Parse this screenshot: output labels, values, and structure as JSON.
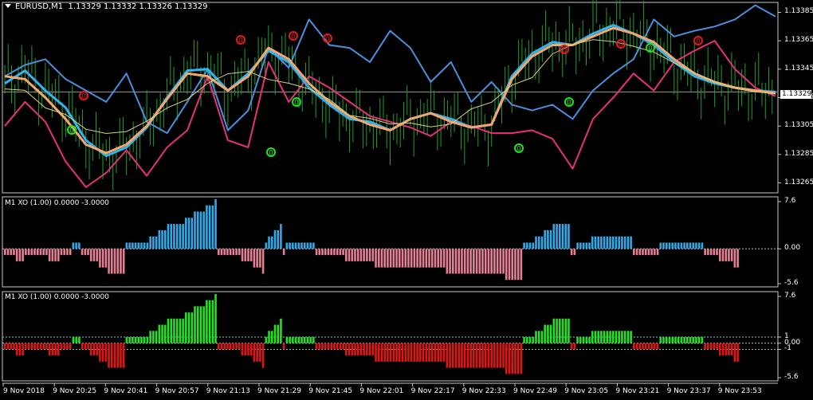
{
  "window": {
    "symbol_header": "EURUSD,M1  1.13329 1.13332 1.13326 1.13329",
    "current_price": "1.13329"
  },
  "price_axis": {
    "labels": [
      "1.13385",
      "1.13365",
      "1.13345",
      "1.13325",
      "1.13305",
      "1.13285",
      "1.13265"
    ],
    "ylim": [
      1.13258,
      1.13392
    ]
  },
  "indicator1": {
    "label": "M1 XO (1.00) 0.0000 -3.0000",
    "scale_labels": [
      "7.6",
      "0.00",
      "-5.6"
    ],
    "ylim": [
      -5.6,
      7.6
    ],
    "colors": {
      "up": "#30a9e8",
      "down": "#e57f94"
    }
  },
  "indicator2": {
    "label": "M1 XO (1.00) 0.0000 -3.0000",
    "scale_labels": [
      "7.6",
      "1",
      "0.00",
      "-1",
      "-5.6"
    ],
    "ylim": [
      -5.6,
      7.6
    ],
    "colors": {
      "up": "#22e11f",
      "down": "#e01512"
    }
  },
  "time_axis": {
    "labels": [
      "9 Nov 2018",
      "9 Nov 20:25",
      "9 Nov 20:41",
      "9 Nov 20:57",
      "9 Nov 21:13",
      "9 Nov 21:29",
      "9 Nov 21:45",
      "9 Nov 22:01",
      "9 Nov 22:17",
      "9 Nov 22:33",
      "9 Nov 22:49",
      "9 Nov 23:05",
      "9 Nov 23:21",
      "9 Nov 23:37",
      "9 Nov 23:53"
    ]
  },
  "markers": {
    "sell_glyph": "0",
    "buy_glyph": "0",
    "sell_color": "#e01b1b",
    "buy_color": "#22e11f"
  },
  "chart_data": [
    {
      "type": "line",
      "title": "EURUSD,M1",
      "series": [
        {
          "name": "",
          "color": "#4b8fdc",
          "x": [
            0,
            6,
            12,
            18,
            24,
            30,
            36,
            42,
            48,
            54,
            60,
            66,
            72,
            78,
            84,
            90,
            96,
            102,
            108,
            114,
            120,
            126,
            132,
            138,
            144,
            150,
            156,
            162,
            168,
            174,
            180,
            186,
            192,
            198,
            204,
            210,
            216,
            222,
            228
          ],
          "values": [
            1.1334,
            1.13348,
            1.13352,
            1.13338,
            1.1333,
            1.13322,
            1.13342,
            1.13308,
            1.133,
            1.13322,
            1.13345,
            1.13302,
            1.13316,
            1.1336,
            1.13346,
            1.1338,
            1.13362,
            1.1336,
            1.1335,
            1.13372,
            1.1336,
            1.13336,
            1.1335,
            1.13322,
            1.13336,
            1.1332,
            1.13316,
            1.1332,
            1.1331,
            1.1333,
            1.13342,
            1.13352,
            1.1338,
            1.13368,
            1.13372,
            1.13375,
            1.1338,
            1.1339,
            1.13382
          ]
        },
        {
          "name": "",
          "color": "#e8307a",
          "x": [
            0,
            6,
            12,
            18,
            24,
            30,
            36,
            42,
            48,
            54,
            60,
            66,
            72,
            78,
            84,
            90,
            96,
            102,
            108,
            114,
            120,
            126,
            132,
            138,
            144,
            150,
            156,
            162,
            168,
            174,
            180,
            186,
            192,
            198,
            204,
            210,
            216,
            222,
            228
          ],
          "values": [
            1.13305,
            1.13322,
            1.13308,
            1.1328,
            1.13262,
            1.13272,
            1.13288,
            1.1327,
            1.1329,
            1.13302,
            1.1334,
            1.13295,
            1.1329,
            1.1335,
            1.13322,
            1.1334,
            1.13332,
            1.13322,
            1.13312,
            1.13308,
            1.13304,
            1.13298,
            1.13308,
            1.13305,
            1.133,
            1.133,
            1.13302,
            1.13296,
            1.13275,
            1.1331,
            1.13325,
            1.13342,
            1.1333,
            1.1335,
            1.13358,
            1.13365,
            1.13345,
            1.13332,
            1.13326
          ]
        },
        {
          "name": "",
          "color": "#31b4f2",
          "x": [
            0,
            6,
            12,
            18,
            24,
            30,
            36,
            42,
            48,
            54,
            60,
            66,
            72,
            78,
            84,
            90,
            96,
            102,
            108,
            114,
            120,
            126,
            132,
            138,
            144,
            150,
            156,
            162,
            168,
            174,
            180,
            186,
            192,
            198,
            204,
            210,
            216,
            222,
            228
          ],
          "values": [
            1.13335,
            1.13344,
            1.1333,
            1.13318,
            1.13295,
            1.13284,
            1.1329,
            1.13304,
            1.13325,
            1.13344,
            1.13345,
            1.1333,
            1.13342,
            1.13358,
            1.1335,
            1.13332,
            1.1332,
            1.1331,
            1.13308,
            1.13302,
            1.1331,
            1.13314,
            1.1331,
            1.13304,
            1.13306,
            1.1334,
            1.13356,
            1.13364,
            1.13362,
            1.1337,
            1.13376,
            1.1337,
            1.13362,
            1.1335,
            1.1334,
            1.13335,
            1.13332,
            1.1333,
            1.13329
          ]
        },
        {
          "name": "",
          "color": "#f5a66c",
          "x": [
            0,
            6,
            12,
            18,
            24,
            30,
            36,
            42,
            48,
            54,
            60,
            66,
            72,
            78,
            84,
            90,
            96,
            102,
            108,
            114,
            120,
            126,
            132,
            138,
            144,
            150,
            156,
            162,
            168,
            174,
            180,
            186,
            192,
            198,
            204,
            210,
            216,
            222,
            228
          ],
          "values": [
            1.1334,
            1.13338,
            1.13325,
            1.1331,
            1.13292,
            1.13286,
            1.13292,
            1.13305,
            1.13324,
            1.13342,
            1.1334,
            1.1333,
            1.1334,
            1.1336,
            1.13352,
            1.13335,
            1.13322,
            1.13312,
            1.13306,
            1.13302,
            1.1331,
            1.13314,
            1.13308,
            1.13304,
            1.13306,
            1.13338,
            1.13354,
            1.13362,
            1.13362,
            1.13368,
            1.13374,
            1.1337,
            1.13364,
            1.13352,
            1.13342,
            1.13336,
            1.13332,
            1.1333,
            1.13328
          ]
        }
      ]
    },
    {
      "type": "bar",
      "title": "M1 XO (1.00) 0.0000 -3.0000",
      "ylim": [
        -5.6,
        7.6
      ],
      "values": [
        -1,
        -1,
        -1,
        -1,
        -2,
        -2,
        -2,
        -1,
        -1,
        -1,
        -1,
        -1,
        -1,
        -1,
        -1,
        -2,
        -2,
        -2,
        -2,
        -1,
        -1,
        -1,
        -1,
        1,
        1,
        1,
        -1,
        -1,
        -1,
        -2,
        -2,
        -2,
        -3,
        -3,
        -3,
        -4,
        -4,
        -4,
        -4,
        -4,
        -4,
        1,
        1,
        1,
        1,
        1,
        1,
        1,
        1,
        2,
        2,
        2,
        3,
        3,
        3,
        4,
        4,
        4,
        4,
        4,
        4,
        5,
        5,
        5,
        6,
        6,
        6,
        6,
        7,
        7,
        7,
        8,
        -1,
        -1,
        -1,
        -1,
        -1,
        -1,
        -1,
        -1,
        -2,
        -2,
        -2,
        -2,
        -3,
        -3,
        -3,
        -4,
        1,
        2,
        2,
        3,
        3,
        4,
        -1,
        1,
        1,
        1,
        1,
        1,
        1,
        1,
        1,
        1,
        1,
        -1,
        -1,
        -1,
        -1,
        -1,
        -1,
        -1,
        -1,
        -1,
        -1,
        -2,
        -2,
        -2,
        -2,
        -2,
        -2,
        -2,
        -2,
        -2,
        -2,
        -3,
        -3,
        -3,
        -3,
        -3,
        -3,
        -3,
        -3,
        -3,
        -3,
        -3,
        -3,
        -3,
        -3,
        -3,
        -3,
        -3,
        -3,
        -3,
        -3,
        -3,
        -3,
        -3,
        -3,
        -4,
        -4,
        -4,
        -4,
        -4,
        -4,
        -4,
        -4,
        -4,
        -4,
        -4,
        -4,
        -4,
        -4,
        -4,
        -4,
        -4,
        -4,
        -4,
        -4,
        -5,
        -5,
        -5,
        -5,
        -5,
        -5,
        1,
        1,
        1,
        1,
        2,
        2,
        2,
        3,
        3,
        3,
        4,
        4,
        4,
        4,
        4,
        4,
        -1,
        -1,
        1,
        1,
        1,
        1,
        1,
        2,
        2,
        2,
        2,
        2,
        2,
        2,
        2,
        2,
        2,
        2,
        2,
        2,
        2,
        -1,
        -1,
        -1,
        -1,
        -1,
        -1,
        -1,
        -1,
        -1,
        1,
        1,
        1,
        1,
        1,
        1,
        1,
        1,
        1,
        1,
        1,
        1,
        1,
        1,
        1,
        -1,
        -1,
        -1,
        -1,
        -1,
        -2,
        -2,
        -2,
        -2,
        -2,
        -3,
        -3
      ]
    },
    {
      "type": "bar",
      "title": "M1 XO (1.00) 0.0000 -3.0000",
      "ylim": [
        -5.6,
        7.6
      ],
      "values": [
        -1,
        -1,
        -1,
        -1,
        -2,
        -2,
        -2,
        -1,
        -1,
        -1,
        -1,
        -1,
        -1,
        -1,
        -1,
        -2,
        -2,
        -2,
        -2,
        -1,
        -1,
        -1,
        -1,
        1,
        1,
        1,
        -1,
        -1,
        -1,
        -2,
        -2,
        -2,
        -3,
        -3,
        -3,
        -4,
        -4,
        -4,
        -4,
        -4,
        -4,
        1,
        1,
        1,
        1,
        1,
        1,
        1,
        1,
        2,
        2,
        2,
        3,
        3,
        3,
        4,
        4,
        4,
        4,
        4,
        4,
        5,
        5,
        5,
        6,
        6,
        6,
        6,
        7,
        7,
        7,
        8,
        -1,
        -1,
        -1,
        -1,
        -1,
        -1,
        -1,
        -1,
        -2,
        -2,
        -2,
        -2,
        -3,
        -3,
        -3,
        -4,
        1,
        2,
        2,
        3,
        3,
        4,
        -1,
        1,
        1,
        1,
        1,
        1,
        1,
        1,
        1,
        1,
        1,
        -1,
        -1,
        -1,
        -1,
        -1,
        -1,
        -1,
        -1,
        -1,
        -1,
        -2,
        -2,
        -2,
        -2,
        -2,
        -2,
        -2,
        -2,
        -2,
        -2,
        -3,
        -3,
        -3,
        -3,
        -3,
        -3,
        -3,
        -3,
        -3,
        -3,
        -3,
        -3,
        -3,
        -3,
        -3,
        -3,
        -3,
        -3,
        -3,
        -3,
        -3,
        -3,
        -3,
        -3,
        -4,
        -4,
        -4,
        -4,
        -4,
        -4,
        -4,
        -4,
        -4,
        -4,
        -4,
        -4,
        -4,
        -4,
        -4,
        -4,
        -4,
        -4,
        -4,
        -4,
        -5,
        -5,
        -5,
        -5,
        -5,
        -5,
        1,
        1,
        1,
        1,
        2,
        2,
        2,
        3,
        3,
        3,
        4,
        4,
        4,
        4,
        4,
        4,
        -1,
        -1,
        1,
        1,
        1,
        1,
        1,
        2,
        2,
        2,
        2,
        2,
        2,
        2,
        2,
        2,
        2,
        2,
        2,
        2,
        2,
        -1,
        -1,
        -1,
        -1,
        -1,
        -1,
        -1,
        -1,
        -1,
        1,
        1,
        1,
        1,
        1,
        1,
        1,
        1,
        1,
        1,
        1,
        1,
        1,
        1,
        1,
        -1,
        -1,
        -1,
        -1,
        -1,
        -2,
        -2,
        -2,
        -2,
        -2,
        -3,
        -3
      ]
    }
  ]
}
